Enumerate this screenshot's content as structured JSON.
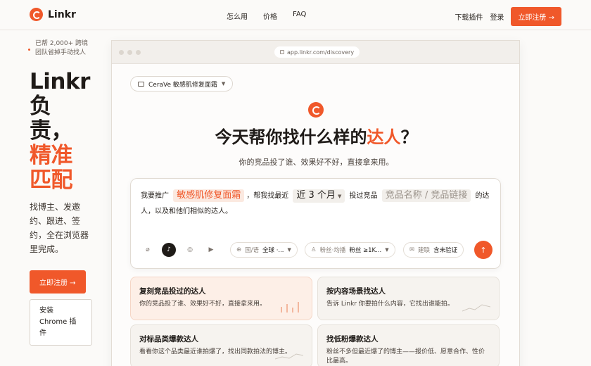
{
  "nav": {
    "brand": "Linkr",
    "links": [
      "怎么用",
      "价格",
      "FAQ"
    ],
    "download": "下载插件",
    "login": "登录",
    "signup": "立即注册 →"
  },
  "left": {
    "helped_line1": "已帮 2,000+ 跨境",
    "helped_line2": "团队省掉手动找人",
    "title_l1": "Linkr",
    "title_l2": "负",
    "title_l3": "责，",
    "title_l4": "精准",
    "title_l5": "匹配",
    "desc": "找博主、发邀约、跟进、签约，全在浏览器里完成。",
    "signup": "立即注册 →",
    "install": "安装 Chrome 插件"
  },
  "browser": {
    "url": "app.linkr.com/discovery",
    "product_pill": "CeraVe 敏感肌修复面霜",
    "title_prefix": "今天帮你找什么样的",
    "title_accent": "达人",
    "title_suffix": "？",
    "subtitle": "你的竞品投了谁、效果好不好，直接拿来用。",
    "prompt": {
      "p1": "我要推广",
      "chip_product": "敏感肌修复面霜",
      "p2": "，帮我找最近",
      "chip_period": "近 3 个月",
      "p3": "投过竞品",
      "chip_placeholder": "竞品名称 / 竞品链接",
      "p4": "的达人，以及和他们相似的达人。"
    },
    "tools": {
      "attach_icon": "paperclip-icon",
      "tiktok_icon": "tiktok-icon",
      "instagram_icon": "instagram-icon",
      "youtube_icon": "youtube-icon",
      "region_label": "国/语",
      "region_value": "全球 ·...",
      "fans_label": "粉丝·均播",
      "fans_value": "粉丝 ≥1K...",
      "contact_label": "建联",
      "contact_value": "含未验证",
      "send_icon": "arrow-up-icon"
    },
    "cards": [
      {
        "title": "复刻竞品投过的达人",
        "desc": "你的竞品投了谁、效果好不好，直接拿来用。"
      },
      {
        "title": "按内容场景找达人",
        "desc": "告诉 Linkr 你要拍什么内容，它找出谁能拍。"
      },
      {
        "title": "对标品类爆款达人",
        "desc": "看看你这个品类最近谁拍爆了，找出同款拍法的博主。"
      },
      {
        "title": "找低粉爆款达人",
        "desc": "粉丝不多但最近爆了的博主——报价低、愿意合作、性价比最高。"
      }
    ]
  },
  "colors": {
    "accent": "#f0582a",
    "text": "#1f1b18",
    "background": "#fbfaf8"
  }
}
